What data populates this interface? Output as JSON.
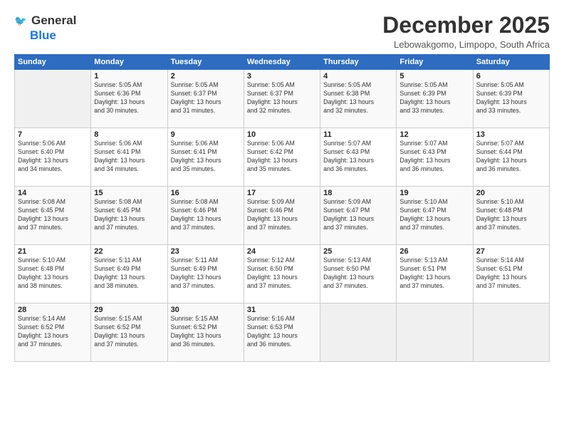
{
  "logo": {
    "line1": "General",
    "line2": "Blue"
  },
  "title": "December 2025",
  "location": "Lebowakgomo, Limpopo, South Africa",
  "days_of_week": [
    "Sunday",
    "Monday",
    "Tuesday",
    "Wednesday",
    "Thursday",
    "Friday",
    "Saturday"
  ],
  "weeks": [
    [
      {
        "day": "",
        "detail": ""
      },
      {
        "day": "1",
        "detail": "Sunrise: 5:05 AM\nSunset: 6:36 PM\nDaylight: 13 hours\nand 30 minutes."
      },
      {
        "day": "2",
        "detail": "Sunrise: 5:05 AM\nSunset: 6:37 PM\nDaylight: 13 hours\nand 31 minutes."
      },
      {
        "day": "3",
        "detail": "Sunrise: 5:05 AM\nSunset: 6:37 PM\nDaylight: 13 hours\nand 32 minutes."
      },
      {
        "day": "4",
        "detail": "Sunrise: 5:05 AM\nSunset: 6:38 PM\nDaylight: 13 hours\nand 32 minutes."
      },
      {
        "day": "5",
        "detail": "Sunrise: 5:05 AM\nSunset: 6:39 PM\nDaylight: 13 hours\nand 33 minutes."
      },
      {
        "day": "6",
        "detail": "Sunrise: 5:05 AM\nSunset: 6:39 PM\nDaylight: 13 hours\nand 33 minutes."
      }
    ],
    [
      {
        "day": "7",
        "detail": "Sunrise: 5:06 AM\nSunset: 6:40 PM\nDaylight: 13 hours\nand 34 minutes."
      },
      {
        "day": "8",
        "detail": "Sunrise: 5:06 AM\nSunset: 6:41 PM\nDaylight: 13 hours\nand 34 minutes."
      },
      {
        "day": "9",
        "detail": "Sunrise: 5:06 AM\nSunset: 6:41 PM\nDaylight: 13 hours\nand 35 minutes."
      },
      {
        "day": "10",
        "detail": "Sunrise: 5:06 AM\nSunset: 6:42 PM\nDaylight: 13 hours\nand 35 minutes."
      },
      {
        "day": "11",
        "detail": "Sunrise: 5:07 AM\nSunset: 6:43 PM\nDaylight: 13 hours\nand 36 minutes."
      },
      {
        "day": "12",
        "detail": "Sunrise: 5:07 AM\nSunset: 6:43 PM\nDaylight: 13 hours\nand 36 minutes."
      },
      {
        "day": "13",
        "detail": "Sunrise: 5:07 AM\nSunset: 6:44 PM\nDaylight: 13 hours\nand 36 minutes."
      }
    ],
    [
      {
        "day": "14",
        "detail": "Sunrise: 5:08 AM\nSunset: 6:45 PM\nDaylight: 13 hours\nand 37 minutes."
      },
      {
        "day": "15",
        "detail": "Sunrise: 5:08 AM\nSunset: 6:45 PM\nDaylight: 13 hours\nand 37 minutes."
      },
      {
        "day": "16",
        "detail": "Sunrise: 5:08 AM\nSunset: 6:46 PM\nDaylight: 13 hours\nand 37 minutes."
      },
      {
        "day": "17",
        "detail": "Sunrise: 5:09 AM\nSunset: 6:46 PM\nDaylight: 13 hours\nand 37 minutes."
      },
      {
        "day": "18",
        "detail": "Sunrise: 5:09 AM\nSunset: 6:47 PM\nDaylight: 13 hours\nand 37 minutes."
      },
      {
        "day": "19",
        "detail": "Sunrise: 5:10 AM\nSunset: 6:47 PM\nDaylight: 13 hours\nand 37 minutes."
      },
      {
        "day": "20",
        "detail": "Sunrise: 5:10 AM\nSunset: 6:48 PM\nDaylight: 13 hours\nand 37 minutes."
      }
    ],
    [
      {
        "day": "21",
        "detail": "Sunrise: 5:10 AM\nSunset: 6:48 PM\nDaylight: 13 hours\nand 38 minutes."
      },
      {
        "day": "22",
        "detail": "Sunrise: 5:11 AM\nSunset: 6:49 PM\nDaylight: 13 hours\nand 38 minutes."
      },
      {
        "day": "23",
        "detail": "Sunrise: 5:11 AM\nSunset: 6:49 PM\nDaylight: 13 hours\nand 37 minutes."
      },
      {
        "day": "24",
        "detail": "Sunrise: 5:12 AM\nSunset: 6:50 PM\nDaylight: 13 hours\nand 37 minutes."
      },
      {
        "day": "25",
        "detail": "Sunrise: 5:13 AM\nSunset: 6:50 PM\nDaylight: 13 hours\nand 37 minutes."
      },
      {
        "day": "26",
        "detail": "Sunrise: 5:13 AM\nSunset: 6:51 PM\nDaylight: 13 hours\nand 37 minutes."
      },
      {
        "day": "27",
        "detail": "Sunrise: 5:14 AM\nSunset: 6:51 PM\nDaylight: 13 hours\nand 37 minutes."
      }
    ],
    [
      {
        "day": "28",
        "detail": "Sunrise: 5:14 AM\nSunset: 6:52 PM\nDaylight: 13 hours\nand 37 minutes."
      },
      {
        "day": "29",
        "detail": "Sunrise: 5:15 AM\nSunset: 6:52 PM\nDaylight: 13 hours\nand 37 minutes."
      },
      {
        "day": "30",
        "detail": "Sunrise: 5:15 AM\nSunset: 6:52 PM\nDaylight: 13 hours\nand 36 minutes."
      },
      {
        "day": "31",
        "detail": "Sunrise: 5:16 AM\nSunset: 6:53 PM\nDaylight: 13 hours\nand 36 minutes."
      },
      {
        "day": "",
        "detail": ""
      },
      {
        "day": "",
        "detail": ""
      },
      {
        "day": "",
        "detail": ""
      }
    ]
  ]
}
